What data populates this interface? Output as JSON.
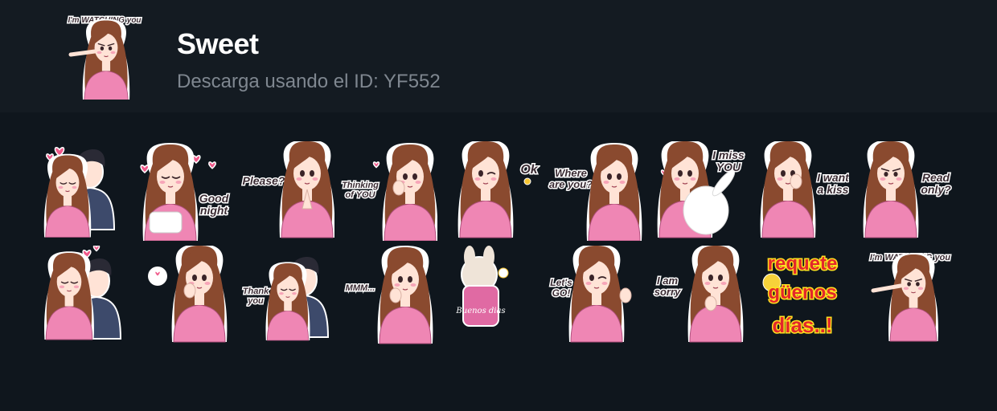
{
  "pack": {
    "title": "Sweet",
    "download_text": "Descarga usando el ID: YF552",
    "thumbnail_caption": "I'm WATCHING you"
  },
  "colors": {
    "background": "#0f161d",
    "header_background": "#141b22",
    "shirt_pink": "#ef86b4",
    "hair_brown": "#8a4a2f",
    "skin": "#ffe3d6",
    "heart_pink": "#f05a8b",
    "jacket_navy": "#3d4a6b"
  },
  "stickers": [
    {
      "id": "hug-couple",
      "caption": "",
      "icon": "hug-couple-icon"
    },
    {
      "id": "good-night",
      "caption": "Good night",
      "icon": "pillow-kiss-icon"
    },
    {
      "id": "please",
      "caption": "Please?",
      "icon": "praying-hands-icon"
    },
    {
      "id": "thinking-of-you",
      "caption": "Thinking of YOU",
      "icon": "thinking-icon"
    },
    {
      "id": "ok",
      "caption": "Ok",
      "icon": "wink-icon"
    },
    {
      "id": "where-are-you",
      "caption": "Where are you?",
      "icon": "hand-on-hip-icon"
    },
    {
      "id": "i-miss-you",
      "caption": "I miss YOU",
      "icon": "bunny-hug-icon"
    },
    {
      "id": "i-want-a-kiss",
      "caption": "I want a kiss",
      "icon": "finger-on-lip-icon"
    },
    {
      "id": "read-only",
      "caption": "Read only?",
      "icon": "angry-face-icon"
    },
    {
      "id": "happy-hug",
      "caption": "",
      "icon": "cheek-hug-icon"
    },
    {
      "id": "heart-bubble",
      "caption": "",
      "icon": "heart-bubble-icon"
    },
    {
      "id": "thank-you",
      "caption": "Thank you",
      "icon": "hug-couple-icon"
    },
    {
      "id": "mmm",
      "caption": "MMM...",
      "icon": "pondering-icon"
    },
    {
      "id": "buenos-dias-bunny",
      "caption": "Buenos dias",
      "icon": "plush-bunny-icon"
    },
    {
      "id": "lets-go",
      "caption": "Let's GO!",
      "icon": "fist-pump-icon"
    },
    {
      "id": "i-am-sorry",
      "caption": "I am sorry",
      "icon": "sorry-icon"
    },
    {
      "id": "requete-guenos-dias",
      "caption": "requete güenos días..!",
      "icon": "chick-icon"
    },
    {
      "id": "watching-you",
      "caption": "I'm WATCHING you",
      "icon": "pointing-eyes-icon"
    }
  ]
}
